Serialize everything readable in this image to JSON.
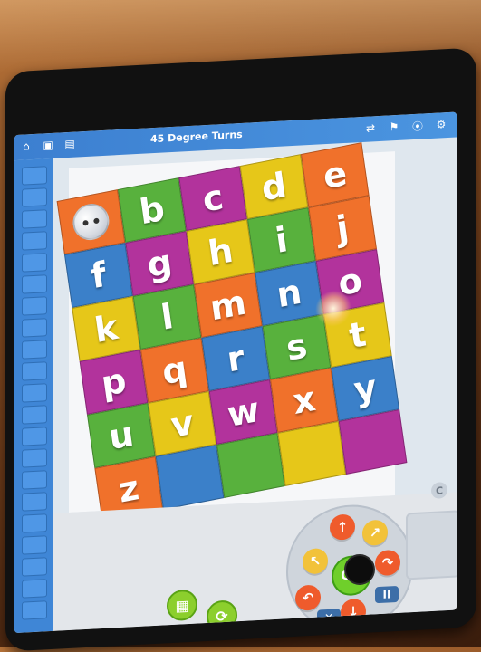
{
  "app": {
    "title": "45 Degree Turns"
  },
  "icons": {
    "left": [
      "home-icon",
      "save-icon",
      "folder-icon"
    ],
    "top_right": [
      "swap-icon",
      "flag-icon",
      "location-icon",
      "settings-icon"
    ]
  },
  "grid": {
    "letters": [
      "",
      "b",
      "c",
      "d",
      "e",
      "f",
      "g",
      "h",
      "i",
      "j",
      "k",
      "l",
      "m",
      "n",
      "o",
      "p",
      "q",
      "r",
      "s",
      "t",
      "u",
      "v",
      "w",
      "x",
      "y",
      "z",
      "",
      "",
      "",
      ""
    ],
    "colors": [
      "#f0712b",
      "#58b13d",
      "#b2339c",
      "#e6c719",
      "#f0712b",
      "#3b80c9",
      "#b2339c",
      "#e6c719",
      "#58b13d",
      "#f0712b",
      "#e6c719",
      "#58b13d",
      "#f0712b",
      "#3b80c9",
      "#b2339c",
      "#b2339c",
      "#f0712b",
      "#3b80c9",
      "#58b13d",
      "#e6c719",
      "#58b13d",
      "#e6c719",
      "#b2339c",
      "#f0712b",
      "#3b80c9",
      "#f0712b",
      "#3b80c9",
      "#58b13d",
      "#e6c719",
      "#b2339c"
    ]
  },
  "controls": {
    "go_label": "GO",
    "copyright": "C"
  }
}
